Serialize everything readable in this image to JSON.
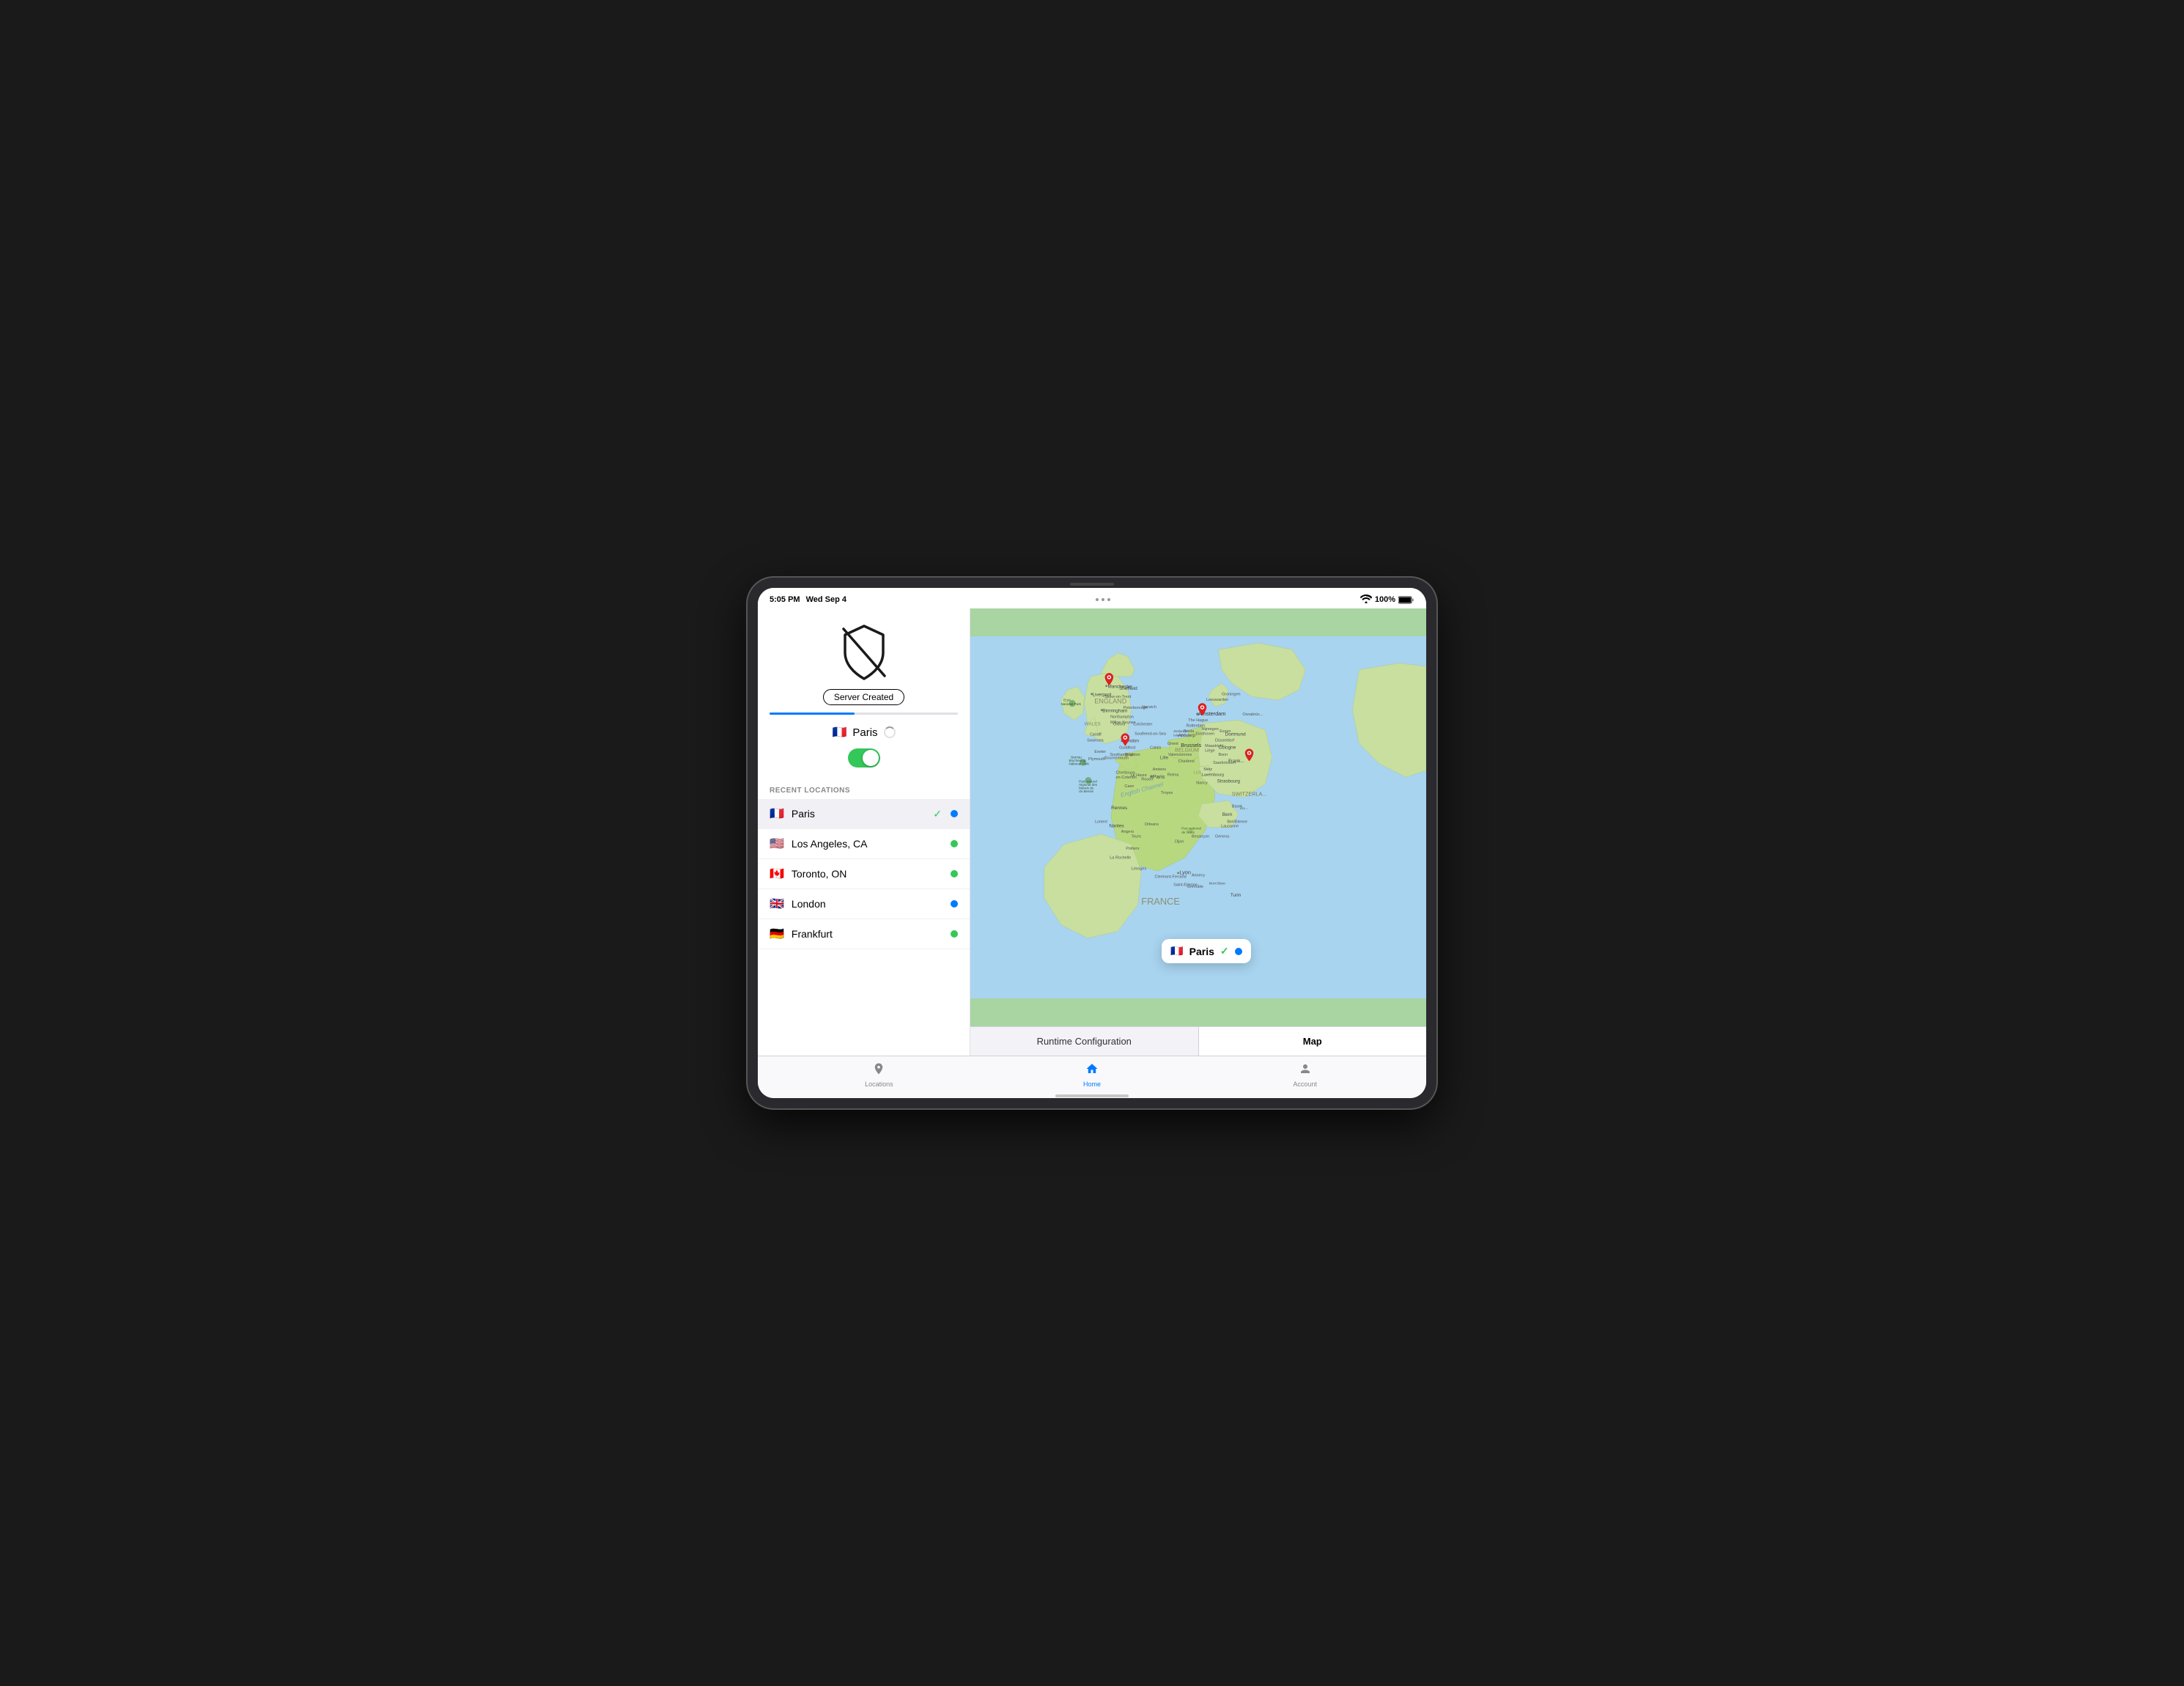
{
  "status_bar": {
    "time": "5:05 PM",
    "date": "Wed Sep 4",
    "battery": "100%",
    "wifi": "WiFi"
  },
  "left_panel": {
    "shield_label": "shield-off",
    "server_created_label": "Server Created",
    "progress_percent": 45,
    "selected_location": "Paris",
    "selected_flag": "🇫🇷",
    "toggle_state": "on",
    "recent_locations_label": "RECENT LOCATIONS",
    "locations": [
      {
        "name": "Paris",
        "flag": "🇫🇷",
        "status": "active",
        "dot": "blue",
        "has_check": true
      },
      {
        "name": "Los Angeles, CA",
        "flag": "🇺🇸",
        "status": "",
        "dot": "green",
        "has_check": false
      },
      {
        "name": "Toronto, ON",
        "flag": "🇨🇦",
        "status": "",
        "dot": "green",
        "has_check": false
      },
      {
        "name": "London",
        "flag": "🇬🇧",
        "status": "",
        "dot": "blue",
        "has_check": false
      },
      {
        "name": "Frankfurt",
        "flag": "🇩🇪",
        "status": "",
        "dot": "green",
        "has_check": false
      }
    ]
  },
  "map": {
    "popup_location": "Paris",
    "popup_flag": "🇫🇷"
  },
  "map_tabs": [
    {
      "label": "Runtime Configuration",
      "active": false
    },
    {
      "label": "Map",
      "active": true
    }
  ],
  "bottom_tabs": [
    {
      "label": "Locations",
      "icon": "location",
      "active": false
    },
    {
      "label": "Home",
      "icon": "home",
      "active": true
    },
    {
      "label": "Account",
      "icon": "person",
      "active": false
    }
  ]
}
